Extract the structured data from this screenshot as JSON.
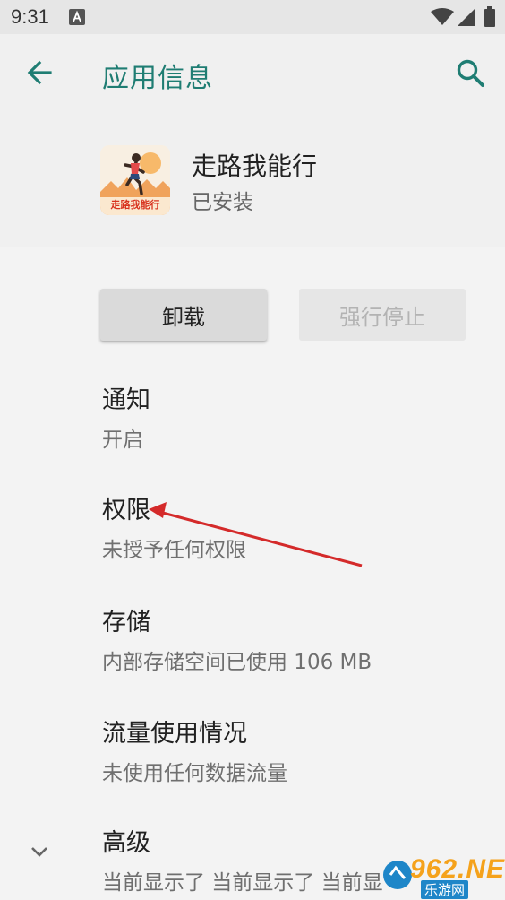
{
  "status_bar": {
    "time": "9:31",
    "notification_icon": "a-square-icon",
    "icons": [
      "wifi-icon",
      "signal-icon",
      "battery-icon"
    ]
  },
  "header": {
    "title": "应用信息",
    "back_icon": "arrow-back-icon",
    "search_icon": "search-icon"
  },
  "app": {
    "name": "走路我能行",
    "status": "已安装",
    "icon_text": "走路我能行"
  },
  "actions": {
    "uninstall_label": "卸载",
    "force_stop_label": "强行停止"
  },
  "settings": [
    {
      "title": "通知",
      "summary": "开启"
    },
    {
      "title": "权限",
      "summary": "未授予任何权限"
    },
    {
      "title": "存储",
      "summary": "内部存储空间已使用 106 MB"
    },
    {
      "title": "流量使用情况",
      "summary": "未使用任何数据流量"
    },
    {
      "title": "高级",
      "summary": "当前显示了 当前显示了 当前显"
    }
  ],
  "watermark": {
    "text": "962.NET",
    "sub": "乐游网"
  },
  "colors": {
    "accent": "#1f7d73",
    "annotation_arrow": "#d42a2a",
    "background": "#f3f3f3"
  }
}
